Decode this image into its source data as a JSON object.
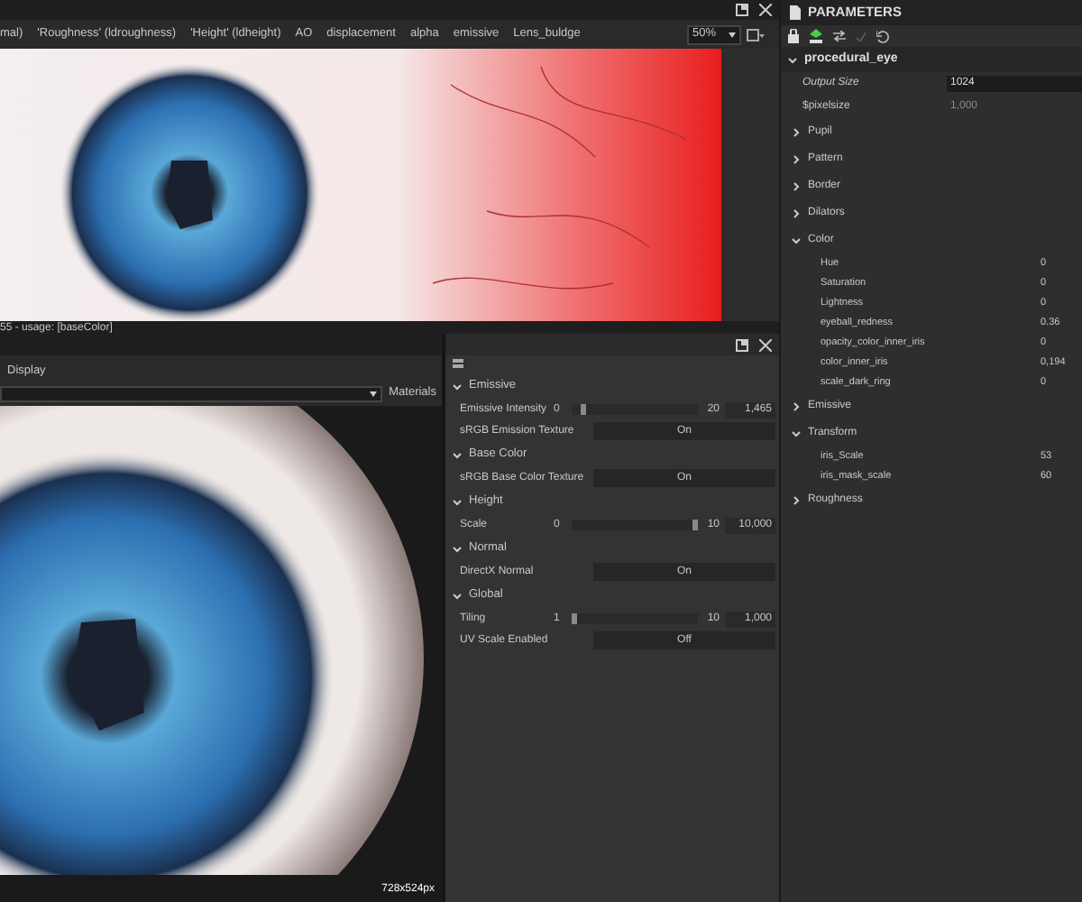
{
  "viewer2d": {
    "tabs": [
      "mal)",
      "'Roughness' (ldroughness)",
      "'Height' (ldheight)",
      "AO",
      "displacement",
      "alpha",
      "emissive",
      "Lens_buldge"
    ],
    "zoom": "50%",
    "status": "55 - usage: [baseColor]"
  },
  "viewer3d": {
    "tab": "Display",
    "materials": "Materials",
    "resolution": "728x524px"
  },
  "material_panel": {
    "sections": [
      {
        "title": "Emissive",
        "expanded": true,
        "rows": [
          {
            "kind": "slider",
            "label": "Emissive Intensity",
            "min": "0",
            "max": "20",
            "value": "1,465",
            "level": 0.07
          },
          {
            "kind": "toggle",
            "label": "sRGB Emission Texture",
            "value": "On"
          }
        ]
      },
      {
        "title": "Base Color",
        "expanded": true,
        "rows": [
          {
            "kind": "toggle",
            "label": "sRGB Base Color Texture",
            "value": "On"
          }
        ]
      },
      {
        "title": "Height",
        "expanded": true,
        "rows": [
          {
            "kind": "slider",
            "label": "Scale",
            "min": "0",
            "max": "10",
            "value": "10,000",
            "level": 1
          }
        ]
      },
      {
        "title": "Normal",
        "expanded": true,
        "rows": [
          {
            "kind": "toggle",
            "label": "DirectX Normal",
            "value": "On"
          }
        ]
      },
      {
        "title": "Global",
        "expanded": true,
        "rows": [
          {
            "kind": "slider",
            "label": "Tiling",
            "min": "1",
            "max": "10",
            "value": "1,000",
            "level": 0
          },
          {
            "kind": "toggle",
            "label": "UV Scale Enabled",
            "value": "Off"
          }
        ]
      }
    ]
  },
  "parameters": {
    "title": "PARAMETERS",
    "graph": "procedural_eye",
    "output_size": {
      "label": "Output Size",
      "value": "1024"
    },
    "pixelsize": {
      "label": "$pixelsize",
      "value": "1,000"
    },
    "groups": [
      {
        "label": "Pupil",
        "expanded": false
      },
      {
        "label": "Pattern",
        "expanded": false
      },
      {
        "label": "Border",
        "expanded": false
      },
      {
        "label": "Dilators",
        "expanded": false
      },
      {
        "label": "Color",
        "expanded": true,
        "params": [
          {
            "label": "Hue",
            "value": "0"
          },
          {
            "label": "Saturation",
            "value": "0"
          },
          {
            "label": "Lightness",
            "value": "0"
          },
          {
            "label": "eyeball_redness",
            "value": "0.36"
          },
          {
            "label": "opacity_color_inner_iris",
            "value": "0"
          },
          {
            "label": "color_inner_iris",
            "value": "0,194"
          },
          {
            "label": "scale_dark_ring",
            "value": "0"
          }
        ]
      },
      {
        "label": "Emissive",
        "expanded": false
      },
      {
        "label": "Transform",
        "expanded": true,
        "params": [
          {
            "label": "iris_Scale",
            "value": "53"
          },
          {
            "label": "iris_mask_scale",
            "value": "60"
          }
        ]
      },
      {
        "label": "Roughness",
        "expanded": false
      }
    ]
  }
}
